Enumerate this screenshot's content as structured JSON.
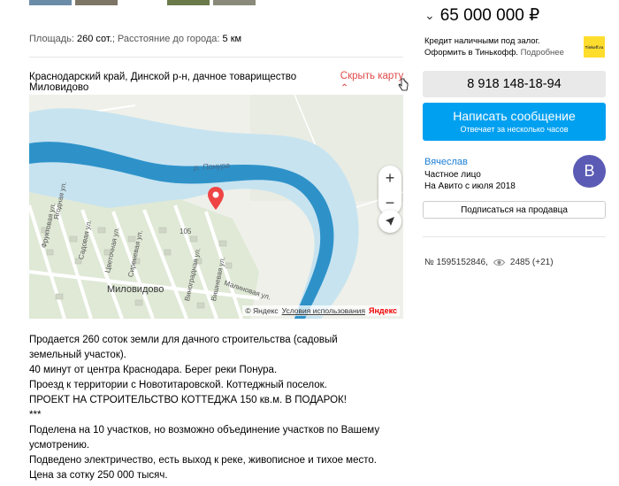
{
  "params": {
    "area_label": "Площадь:",
    "area_value": "260 сот.",
    "distance_label": "; Расстояние до города:",
    "distance_value": "5 км"
  },
  "address": {
    "text": "Краснодарский край, Динской р-н, дачное товарищество Миловидово",
    "toggle_label": "Скрыть карту",
    "toggle_icon": "chevron-up-icon"
  },
  "map": {
    "river_label": "р. Понура",
    "town_label": "Миловидово",
    "house_number": "105",
    "streets": [
      "Ягодная ул.",
      "Фруктовая ул.",
      "Садовая ул.",
      "Цветочная ул.",
      "Сиреневая ул.",
      "Виноградная ул.",
      "Вишневая ул.",
      "Малиновая ул."
    ],
    "zoom_in": "+",
    "zoom_out": "−",
    "copyright": "© Яндекс",
    "terms": "Условия использования",
    "logo": "Яндекс",
    "colors": {
      "land": "#eef0e9",
      "water": "#c7e3f0",
      "river": "#2e92c9",
      "pin": "#ef4444"
    }
  },
  "description": [
    "Продается 260 соток земли для дачного строительства (садовый земельный участок).",
    "40 минут от центра Краснодара. Берег реки Понура.",
    "Проезд к территории с Новотитаровской. Коттеджный поселок.",
    "ПРОЕКТ НА СТРОИТЕЛЬСТВО КОТТЕДЖА 150 кв.м. В ПОДАРОК!",
    "***",
    "Поделена на 10 участков, но возможно объединение участков по Вашему усмотрению.",
    "Подведено электричество, есть выход к реке, живописное и тихое место.",
    "Цена за сотку 250 000 тысяч."
  ],
  "price": {
    "chevron": "⌄",
    "value": "65 000 000 ₽"
  },
  "credit": {
    "line1": "Кредит наличными под залог.",
    "line2": "Оформить в Тинькофф.",
    "more": "Подробнее",
    "logo_text": "Tinkoff.ru"
  },
  "contact": {
    "phone": "8 918 148-18-94",
    "message_label": "Написать сообщение",
    "message_sub": "Отвечает за несколько часов"
  },
  "seller": {
    "name": "Вячеслав",
    "type": "Частное лицо",
    "since": "На Авито с июля 2018",
    "avatar_letter": "B",
    "subscribe_label": "Подписаться на продавца"
  },
  "stats": {
    "id": "№ 1595152846,",
    "views": "2485 (+21)"
  }
}
